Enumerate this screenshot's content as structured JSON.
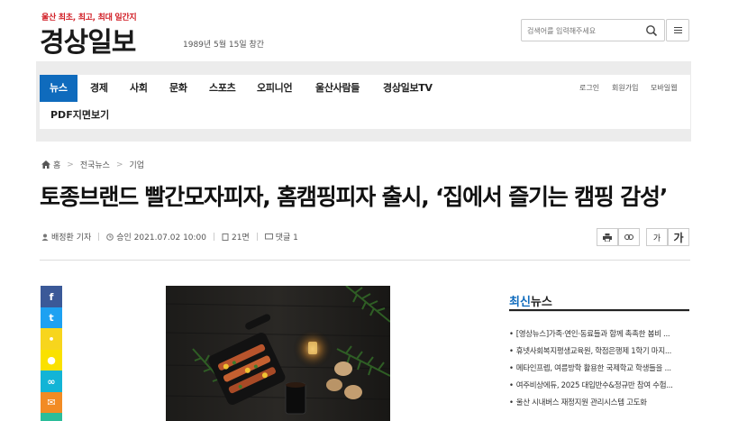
{
  "header": {
    "slogan": "울산 최초, 최고, 최대 일간지",
    "logo": "경상일보",
    "founded": "1989년 5월 15일 창간",
    "search_placeholder": "검색어를 입력해주세요"
  },
  "nav": {
    "items": [
      "뉴스",
      "경제",
      "사회",
      "문화",
      "스포츠",
      "오피니언",
      "울산사람들",
      "경상일보TV"
    ],
    "second_row": "PDF지면보기",
    "utils": [
      "로그인",
      "회원가입",
      "모바일웹"
    ]
  },
  "breadcrumb": [
    "홈",
    "전국뉴스",
    "기업"
  ],
  "article": {
    "title": "토종브랜드 빨간모자피자, 홈캠핑피자 출시, ‘집에서 즐기는 캠핑 감성’",
    "author": "배정환 기자",
    "approved": "승인 2021.07.02 10:00",
    "page": "21면",
    "comments": "댓글 1",
    "font_small": "가",
    "font_large": "가"
  },
  "share": [
    {
      "name": "facebook",
      "glyph": "f",
      "color": "#3b5998"
    },
    {
      "name": "twitter",
      "glyph": "t",
      "color": "#1da1f2"
    },
    {
      "name": "kakaostory",
      "glyph": "•",
      "color": "#f7d51d"
    },
    {
      "name": "kakaotalk",
      "glyph": "●",
      "color": "#fae100"
    },
    {
      "name": "link",
      "glyph": "∞",
      "color": "#12b4d6"
    },
    {
      "name": "email",
      "glyph": "✉",
      "color": "#f28b24"
    },
    {
      "name": "more",
      "glyph": "",
      "color": "#2bbd9a"
    }
  ],
  "sidebar": {
    "title_blue": "최신",
    "title_rest": "뉴스",
    "items": [
      "[영상뉴스]가족·연인·동료들과 함께 촉촉한 봄비 ...",
      "휴넷사회복지평생교육원, 학점은행제 1학기 마지...",
      "메타인프렙, 여름방학 활용한 국제학교 학생들을 ...",
      "여주비상에듀, 2025 대입반수&정규반 참여 수험...",
      "울산 시내버스 재정지원 관리시스템 고도화"
    ]
  }
}
